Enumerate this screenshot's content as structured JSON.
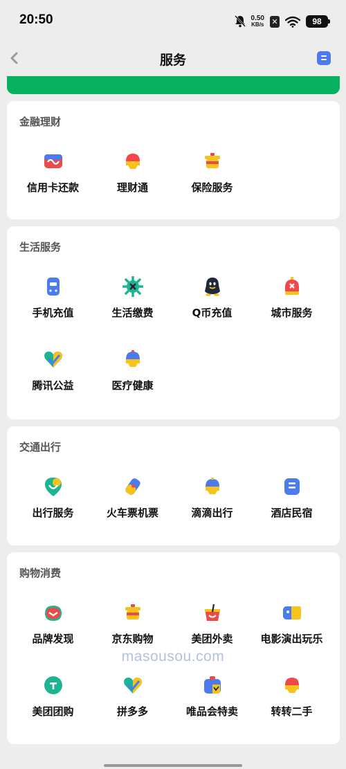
{
  "status": {
    "time": "20:50",
    "net_speed_value": "0.50",
    "net_speed_unit": "KB/s",
    "sim_label": "✕",
    "battery": "98"
  },
  "nav": {
    "title": "服务"
  },
  "sections": [
    {
      "title": "金融理财",
      "items": [
        {
          "label": "信用卡还款",
          "icon": "credit-card-icon"
        },
        {
          "label": "理财通",
          "icon": "wealth-bell-icon"
        },
        {
          "label": "保险服务",
          "icon": "insurance-icon"
        }
      ]
    },
    {
      "title": "生活服务",
      "items": [
        {
          "label": "手机充值",
          "icon": "phone-icon"
        },
        {
          "label": "生活缴费",
          "icon": "utility-icon"
        },
        {
          "label": "Q币充值",
          "icon": "qq-penguin-icon"
        },
        {
          "label": "城市服务",
          "icon": "city-icon"
        },
        {
          "label": "腾讯公益",
          "icon": "heart-icon"
        },
        {
          "label": "医疗健康",
          "icon": "medical-icon"
        }
      ]
    },
    {
      "title": "交通出行",
      "items": [
        {
          "label": "出行服务",
          "icon": "travel-pin-icon"
        },
        {
          "label": "火车票机票",
          "icon": "train-ticket-icon"
        },
        {
          "label": "滴滴出行",
          "icon": "didi-icon"
        },
        {
          "label": "酒店民宿",
          "icon": "hotel-icon"
        }
      ]
    },
    {
      "title": "购物消费",
      "items": [
        {
          "label": "品牌发现",
          "icon": "brand-icon"
        },
        {
          "label": "京东购物",
          "icon": "jd-icon"
        },
        {
          "label": "美团外卖",
          "icon": "meituan-waimai-icon"
        },
        {
          "label": "电影演出玩乐",
          "icon": "movie-icon"
        },
        {
          "label": "美团团购",
          "icon": "meituan-tuangou-icon"
        },
        {
          "label": "拼多多",
          "icon": "pinduoduo-icon"
        },
        {
          "label": "唯品会特卖",
          "icon": "vip-icon"
        },
        {
          "label": "转转二手",
          "icon": "zhuanzhuan-icon"
        }
      ]
    }
  ],
  "watermark": "masousou.com",
  "colors": {
    "green_bar": "#07b15f",
    "accent_blue": "#4b7bec"
  }
}
